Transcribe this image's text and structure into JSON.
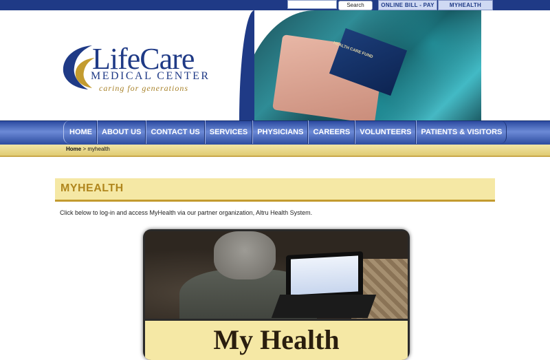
{
  "utility_bar": {
    "search_placeholder": "",
    "search_button": "Search",
    "links": [
      "ONLINE BILL - PAY",
      "MYHEALTH"
    ]
  },
  "header": {
    "logo": {
      "name": "LifeCare",
      "subtitle": "MEDICAL CENTER",
      "tagline": "caring for generations"
    },
    "photo_caption": "HEALTH CARE FUND"
  },
  "nav": {
    "items": [
      "HOME",
      "ABOUT US",
      "CONTACT US",
      "SERVICES",
      "PHYSICIANS",
      "CAREERS",
      "VOLUNTEERS",
      "PATIENTS & VISITORS"
    ]
  },
  "breadcrumb": {
    "home": "Home",
    "separator": ">",
    "current": "myhealth"
  },
  "main": {
    "title": "MYHEALTH",
    "intro": "Click below to log-in and access MyHealth via our partner organization, Altru Health System.",
    "feature": {
      "heading": "My Health"
    }
  },
  "colors": {
    "brand_blue": "#1f3a86",
    "gold": "#c39b2f",
    "cream": "#f5e8a5"
  }
}
